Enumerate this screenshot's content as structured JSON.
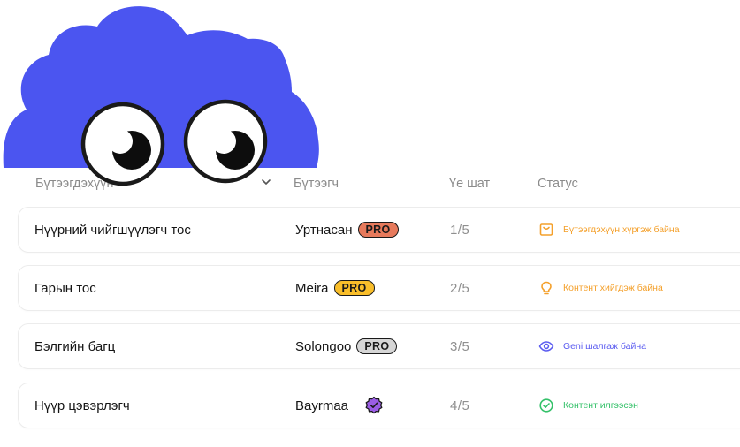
{
  "header": {
    "product": "Бүтээгдэхүүн",
    "maker": "Бүтээгч",
    "stage": "Үе шат",
    "status": "Статус"
  },
  "colors": {
    "mascot": "#4b55f0",
    "pro_orange": "#e77a5c",
    "pro_yellow": "#f9be2a",
    "pro_gray": "#d6d6d6",
    "verified_purple": "#9b5de5",
    "status_orange": "#f4a02b",
    "status_blue": "#5b5cf0",
    "status_green": "#35c16a"
  },
  "rows": [
    {
      "product": "Нүүрний чийгшүүлэгч тос",
      "maker": "Уртнасан",
      "badge": "PRO",
      "badge_style": "orange",
      "stage": "1/5",
      "status": "Бүтээгдэхүүн хүргэж байна",
      "status_icon": "package-icon",
      "status_color": "#f4a02b"
    },
    {
      "product": "Гарын тос",
      "maker": "Meira",
      "badge": "PRO",
      "badge_style": "yellow",
      "stage": "2/5",
      "status": "Контент хийгдэж байна",
      "status_icon": "lightbulb-icon",
      "status_color": "#f4a02b"
    },
    {
      "product": "Бэлгийн багц",
      "maker": "Solongoo",
      "badge": "PRO",
      "badge_style": "gray",
      "stage": "3/5",
      "status": "Geni шалгаж байна",
      "status_icon": "eye-icon",
      "status_color": "#5b5cf0"
    },
    {
      "product": "Нүүр цэвэрлэгч",
      "maker": "Bayrmaa",
      "badge": "",
      "badge_style": "verified",
      "stage": "4/5",
      "status": "Контент илгээсэн",
      "status_icon": "check-circle-icon",
      "status_color": "#35c16a"
    }
  ]
}
